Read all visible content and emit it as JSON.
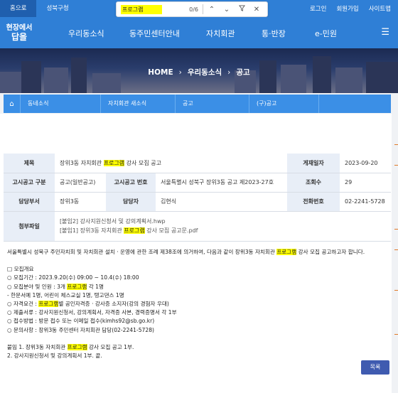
{
  "topbar": {
    "tabs": [
      "홈으로",
      "성북구청"
    ],
    "links": [
      "로그인",
      "회원가입",
      "사이트맵"
    ]
  },
  "findbar": {
    "query": "프로그램",
    "count": "0/6",
    "icons": [
      "arrow-up-icon",
      "arrow-down-icon",
      "filter-icon",
      "close-icon"
    ]
  },
  "logo": {
    "line1": "현장에서",
    "line2": "답을"
  },
  "nav": {
    "items": [
      "우리동소식",
      "동주민센터안내",
      "자치회관",
      "통·반장",
      "e-민원"
    ]
  },
  "hero": {
    "home": "HOME",
    "level1": "우리동소식",
    "level2": "공고"
  },
  "subnav": {
    "items": [
      "동네소식",
      "자치회관 새소식",
      "공고",
      "(구)공고"
    ]
  },
  "detail": {
    "title_label": "제목",
    "title_pre": "장위3동 자치회관 ",
    "title_hl": "프로그램",
    "title_post": " 강사 모집 공고",
    "date_label": "게재일자",
    "date": "2023-09-20",
    "type_label": "고시공고 구분",
    "type": "공고(일반공고)",
    "num_label": "고시공고 번호",
    "num": "서울특별시 성북구 장위3동 공고 제2023-27호",
    "views_label": "조회수",
    "views": "29",
    "dept_label": "담당부서",
    "dept": "장위3동",
    "person_label": "담당자",
    "person": "김현식",
    "phone_label": "전화번호",
    "phone": "02-2241-5728",
    "attach_label": "첨부파일",
    "attach1": "[붙임2] 강사지원신청서 및 강의계획서.hwp",
    "attach2_pre": "[붙임1] 장위3동 자치회관 ",
    "attach2_hl": "프로그램",
    "attach2_post": " 강사 모집 공고문.pdf"
  },
  "body": {
    "intro_pre": "서울특별시 성북구 주민자치회 및 자치회관 설치 · 운영에 관한 조례 제38조에 의거하여, 다음과 같이 장위3동 자치회관 ",
    "intro_hl": "프로그램",
    "intro_post": " 강사 모집 공고하고자 합니다.",
    "heading": "□ 모집개요",
    "l1": "○ 모집기간 : 2023.9.20(수) 09:00 ~ 10.4(수) 18:00",
    "l2_pre": "○ 모집분야 및 인원 : 3개 ",
    "l2_hl": "프로그램",
    "l2_post": " 각 1명",
    "l3": "- 한문서예 1명, 어린이 체스교실 1명, 탱고댄스 1명",
    "l4_pre": "○ 자격요건 : ",
    "l4_hl": "프로그램",
    "l4_post": "별 공인자격증 · 강사증 소지자(강의 경험자 우대)",
    "l5": "○ 제출서류 : 강사지원신청서, 강의계획서, 자격증 사본, 경력증명서 각 1부",
    "l6": "○ 접수방법 : 방문 접수 또는 이메일 접수(kimhs92@sb.go.kr)",
    "l7": "○ 문의사항 : 장위3동 주민센터 자치회관 담당(02-2241-5728)",
    "n1_pre": "붙임 1. 장위3동 자치회관 ",
    "n1_hl": "프로그램",
    "n1_post": " 강사 모집 공고 1부.",
    "n2": "2. 강사지원신청서 및 강의계획서 1부. 끝."
  },
  "list_button": "목록"
}
